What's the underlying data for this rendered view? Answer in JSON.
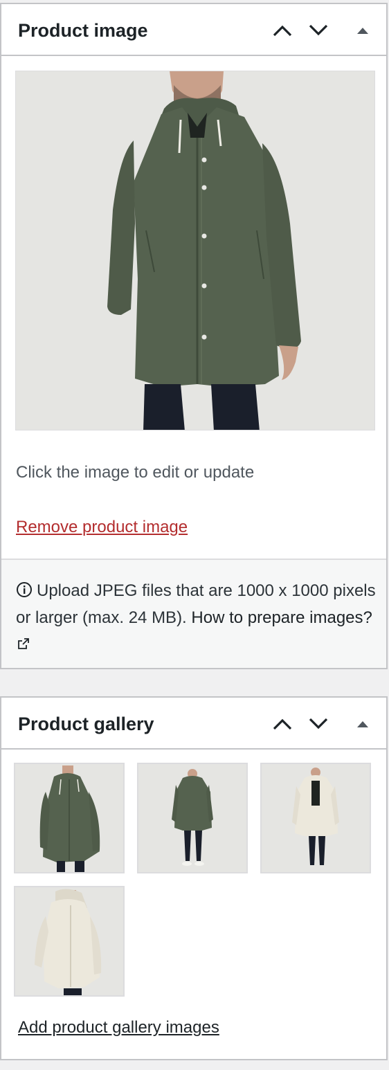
{
  "product_image": {
    "title": "Product image",
    "hint": "Click the image to edit or update",
    "remove_label": "Remove product image",
    "notice_text": "Upload JPEG files that are 1000 x 1000 pixels or larger (max. 24 MB).",
    "howto_label": "How to prepare images?"
  },
  "product_gallery": {
    "title": "Product gallery",
    "add_label": "Add product gallery images"
  },
  "colors": {
    "remove_link": "#b32d2e",
    "border": "#c3c4c7",
    "notice_bg": "#f6f7f7"
  },
  "icons": [
    "chevron-up-icon",
    "chevron-down-icon",
    "triangle-up-icon",
    "info-icon",
    "external-link-icon"
  ]
}
